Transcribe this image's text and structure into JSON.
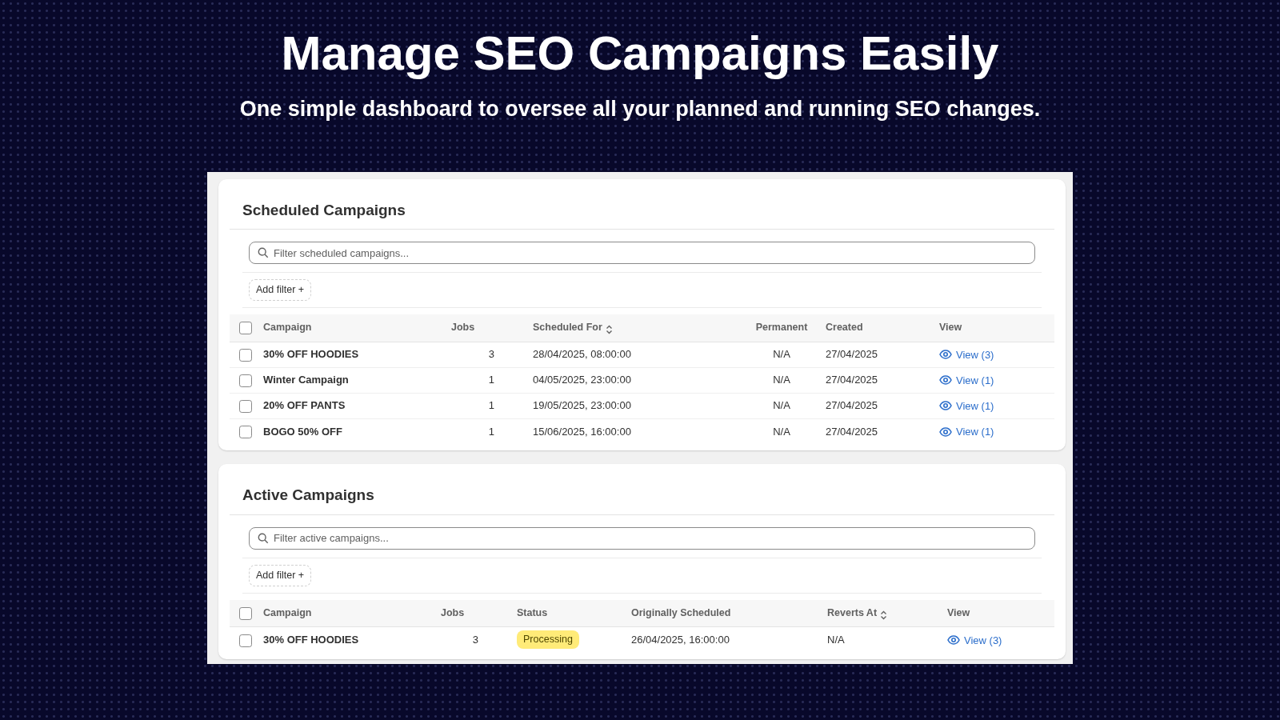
{
  "headline": "Manage SEO Campaigns Easily",
  "subheadline": "One simple dashboard to oversee all your planned and running SEO changes.",
  "sections": [
    {
      "title": "Scheduled Campaigns",
      "filter_placeholder": "Filter scheduled campaigns...",
      "add_filter_label": "Add filter +",
      "all_checked": false,
      "columns": [
        {
          "label": "Campaign",
          "kind": "name",
          "sortable": false
        },
        {
          "label": "Jobs",
          "kind": "number",
          "sortable": false
        },
        {
          "label": "Scheduled For",
          "kind": "text",
          "sortable": true
        },
        {
          "label": "Permanent",
          "kind": "center",
          "sortable": false
        },
        {
          "label": "Created",
          "kind": "text",
          "sortable": false
        },
        {
          "label": "View",
          "kind": "link",
          "sortable": false
        }
      ],
      "rows": [
        {
          "checked": false,
          "cells": [
            "30% OFF HOODIES",
            "3",
            "28/04/2025, 08:00:00",
            "N/A",
            "27/04/2025",
            "View (3)"
          ]
        },
        {
          "checked": false,
          "cells": [
            "Winter Campaign",
            "1",
            "04/05/2025, 23:00:00",
            "N/A",
            "27/04/2025",
            "View (1)"
          ]
        },
        {
          "checked": false,
          "cells": [
            "20% OFF PANTS",
            "1",
            "19/05/2025, 23:00:00",
            "N/A",
            "27/04/2025",
            "View (1)"
          ]
        },
        {
          "checked": false,
          "cells": [
            "BOGO 50% OFF",
            "1",
            "15/06/2025, 16:00:00",
            "N/A",
            "27/04/2025",
            "View (1)"
          ]
        }
      ]
    },
    {
      "title": "Active Campaigns",
      "filter_placeholder": "Filter active campaigns...",
      "add_filter_label": "Add filter +",
      "all_checked": false,
      "columns": [
        {
          "label": "Campaign",
          "kind": "name",
          "sortable": false
        },
        {
          "label": "Jobs",
          "kind": "number",
          "sortable": false
        },
        {
          "label": "Status",
          "kind": "status",
          "sortable": false
        },
        {
          "label": "Originally Scheduled",
          "kind": "text",
          "sortable": false
        },
        {
          "label": "Reverts At",
          "kind": "text",
          "sortable": true
        },
        {
          "label": "View",
          "kind": "link",
          "sortable": false
        }
      ],
      "rows": [
        {
          "checked": false,
          "cells": [
            "30% OFF HOODIES",
            "3",
            "Processing",
            "26/04/2025, 16:00:00",
            "N/A",
            "View (3)"
          ]
        }
      ]
    }
  ]
}
